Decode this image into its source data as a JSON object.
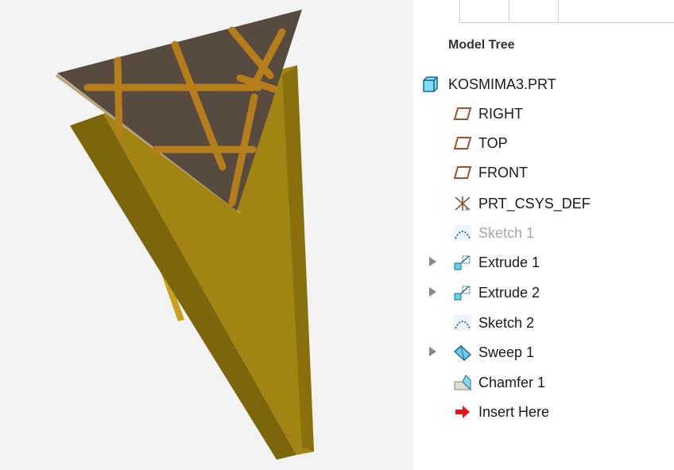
{
  "panel": {
    "title": "Model Tree"
  },
  "tree": [
    {
      "label": "KOSMIMA3.PRT",
      "icon": "part-icon",
      "expandable": false,
      "disabled": false
    },
    {
      "label": "RIGHT",
      "icon": "datum-plane-icon",
      "expandable": false,
      "disabled": false
    },
    {
      "label": "TOP",
      "icon": "datum-plane-icon",
      "expandable": false,
      "disabled": false
    },
    {
      "label": "FRONT",
      "icon": "datum-plane-icon",
      "expandable": false,
      "disabled": false
    },
    {
      "label": "PRT_CSYS_DEF",
      "icon": "coordinate-system-icon",
      "expandable": false,
      "disabled": false
    },
    {
      "label": "Sketch 1",
      "icon": "sketch-icon",
      "expandable": false,
      "disabled": true
    },
    {
      "label": "Extrude 1",
      "icon": "extrude-icon",
      "expandable": true,
      "disabled": false
    },
    {
      "label": "Extrude 2",
      "icon": "extrude-icon",
      "expandable": true,
      "disabled": false
    },
    {
      "label": "Sketch 2",
      "icon": "sketch-icon",
      "expandable": false,
      "disabled": false
    },
    {
      "label": "Sweep 1",
      "icon": "sweep-icon",
      "expandable": true,
      "disabled": false
    },
    {
      "label": "Chamfer 1",
      "icon": "chamfer-icon",
      "expandable": false,
      "disabled": false
    },
    {
      "label": "Insert Here",
      "icon": "insert-arrow-icon",
      "expandable": false,
      "disabled": false
    }
  ],
  "colors": {
    "viewport_background": "#f3f3f3",
    "model_gold": "#9a7d10",
    "model_gold_shade": "#6f5a08",
    "lid_gray": "#54493d",
    "lid_ribs": "#b67e1a",
    "plane_icon": "#a0522d",
    "insert_arrow": "#e8141b"
  }
}
